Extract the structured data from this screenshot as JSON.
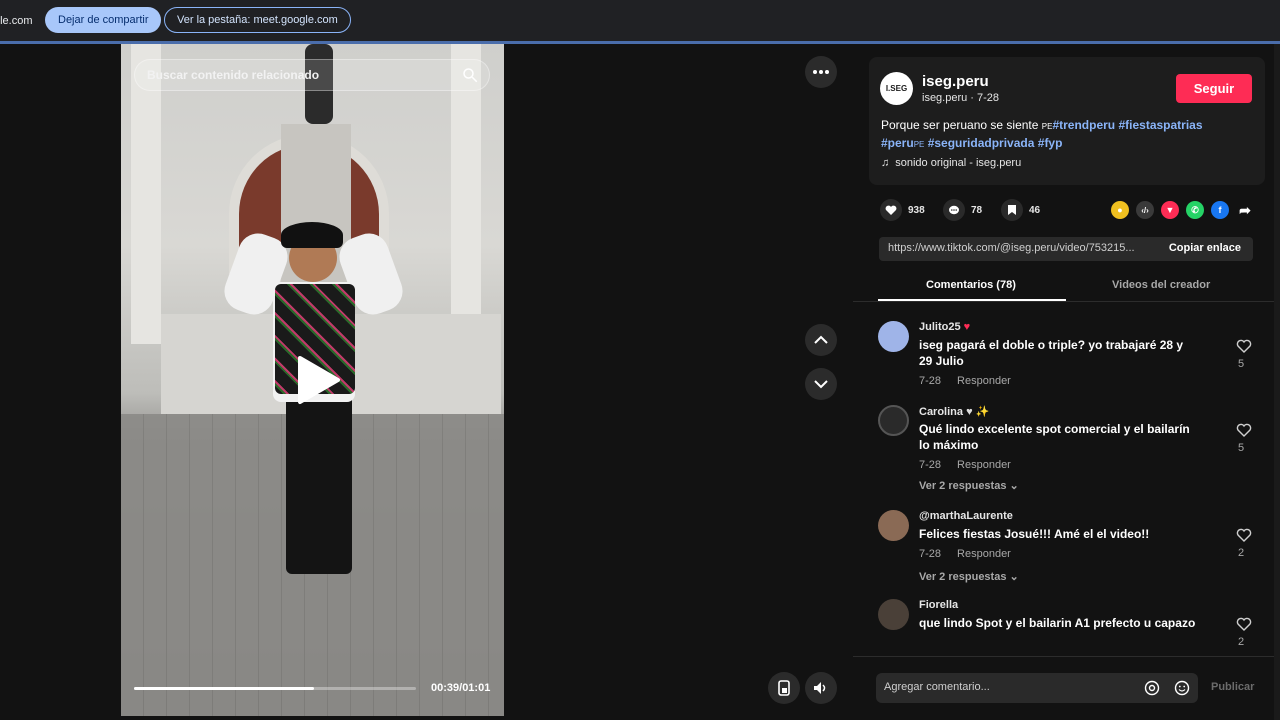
{
  "share_bar": {
    "host_fragment": "gle.com",
    "stop_sharing_label": "Dejar de compartir",
    "view_tab_label": "Ver la pestaña: meet.google.com"
  },
  "video": {
    "search_placeholder": "Buscar contenido relacionado",
    "time": "00:39/01:01",
    "progress_fraction": 0.64
  },
  "author": {
    "avatar_text": "I.SEG",
    "name": "iseg.peru",
    "sub": "iseg.peru · 7-28",
    "follow_label": "Seguir"
  },
  "description": {
    "text": "Porque ser peruano se siente ",
    "flag1": "PE",
    "tag1": "#trendperu",
    "tag2": "#fiestaspatrias",
    "tag3": "#peru",
    "flag2": "PE",
    "tag4": "#seguridadprivada",
    "tag5": "#fyp"
  },
  "music": {
    "label": "sonido original - iseg.peru"
  },
  "stats": {
    "likes": "938",
    "comments": "78",
    "saves": "46"
  },
  "link": {
    "url": "https://www.tiktok.com/@iseg.peru/video/753215...",
    "copy_label": "Copiar enlace"
  },
  "tabs": {
    "comments": "Comentarios (78)",
    "creator_videos": "Videos del creador"
  },
  "comments": [
    {
      "user": "Julito25",
      "text": "iseg pagará el doble o triple? yo trabajaré 28 y 29 Julio",
      "date": "7-28",
      "reply": "Responder",
      "likes": "5",
      "replies": ""
    },
    {
      "user": "Carolina",
      "text": "Qué lindo excelente spot comercial y el bailarín lo máximo",
      "date": "7-28",
      "reply": "Responder",
      "likes": "5",
      "replies": "Ver 2 respuestas"
    },
    {
      "user": "@marthaLaurente",
      "text": "Felices fiestas Josué!!! Amé el el video!!",
      "date": "7-28",
      "reply": "Responder",
      "likes": "2",
      "replies": "Ver 2 respuestas"
    },
    {
      "user": "Fiorella",
      "text": "que lindo Spot y el bailarin A1 prefecto u capazo",
      "date": "",
      "reply": "",
      "likes": "2",
      "replies": ""
    }
  ],
  "comment_bar": {
    "placeholder": "Agregar comentario...",
    "publish_label": "Publicar"
  },
  "colors": {
    "accent": "#fe2c55",
    "tag": "#8ab4f8",
    "share_pill": "#a8c7fa"
  }
}
